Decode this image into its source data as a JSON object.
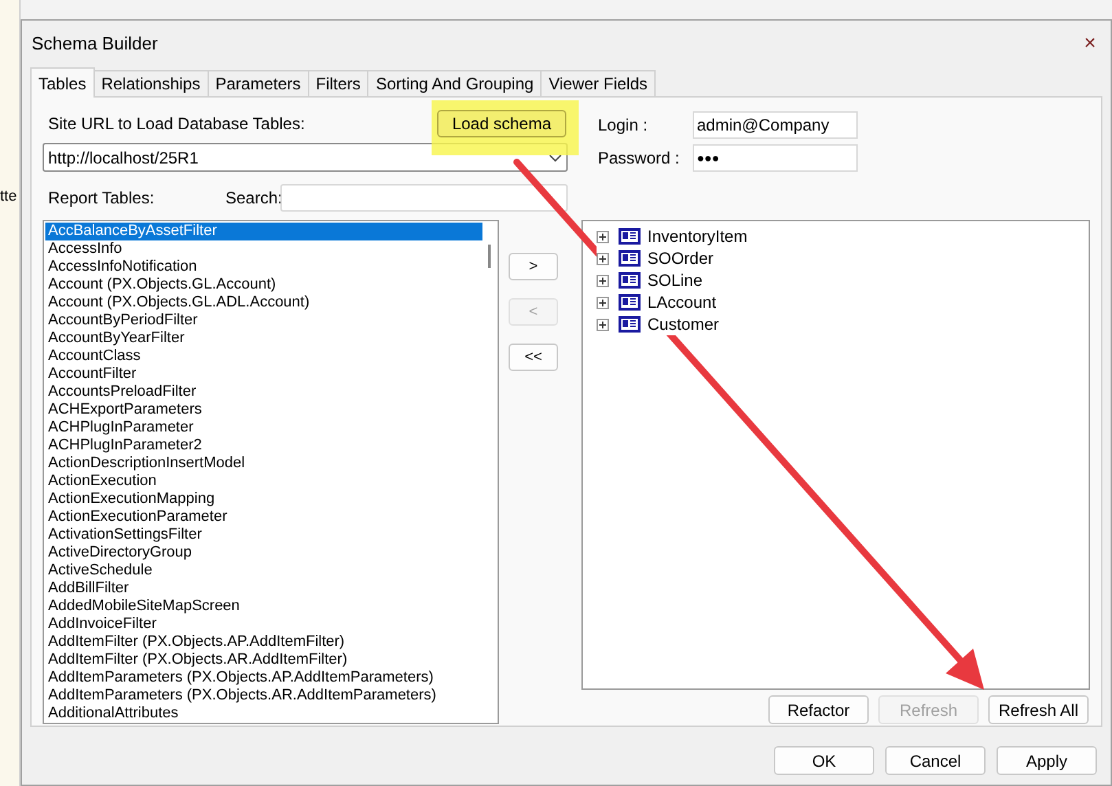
{
  "background_window": {
    "text": "tte"
  },
  "window": {
    "title": "Schema Builder",
    "close": "×"
  },
  "tabs": [
    {
      "label": "Tables",
      "selected": true
    },
    {
      "label": "Relationships",
      "selected": false
    },
    {
      "label": "Parameters",
      "selected": false
    },
    {
      "label": "Filters",
      "selected": false
    },
    {
      "label": "Sorting And Grouping",
      "selected": false
    },
    {
      "label": "Viewer Fields",
      "selected": false
    }
  ],
  "site_url": {
    "label": "Site URL to Load Database Tables:",
    "value": "http://localhost/25R1",
    "load_button": "Load schema"
  },
  "login": {
    "label": "Login :",
    "value": "admin@Company"
  },
  "password": {
    "label": "Password :",
    "value": "●●●"
  },
  "report_tables": {
    "label": "Report Tables:",
    "search_label": "Search:",
    "items": [
      {
        "label": "AccBalanceByAssetFilter",
        "selected": true
      },
      {
        "label": "AccessInfo",
        "selected": false
      },
      {
        "label": "AccessInfoNotification",
        "selected": false
      },
      {
        "label": "Account (PX.Objects.GL.Account)",
        "selected": false
      },
      {
        "label": "Account (PX.Objects.GL.ADL.Account)",
        "selected": false
      },
      {
        "label": "AccountByPeriodFilter",
        "selected": false
      },
      {
        "label": "AccountByYearFilter",
        "selected": false
      },
      {
        "label": "AccountClass",
        "selected": false
      },
      {
        "label": "AccountFilter",
        "selected": false
      },
      {
        "label": "AccountsPreloadFilter",
        "selected": false
      },
      {
        "label": "ACHExportParameters",
        "selected": false
      },
      {
        "label": "ACHPlugInParameter",
        "selected": false
      },
      {
        "label": "ACHPlugInParameter2",
        "selected": false
      },
      {
        "label": "ActionDescriptionInsertModel",
        "selected": false
      },
      {
        "label": "ActionExecution",
        "selected": false
      },
      {
        "label": "ActionExecutionMapping",
        "selected": false
      },
      {
        "label": "ActionExecutionParameter",
        "selected": false
      },
      {
        "label": "ActivationSettingsFilter",
        "selected": false
      },
      {
        "label": "ActiveDirectoryGroup",
        "selected": false
      },
      {
        "label": "ActiveSchedule",
        "selected": false
      },
      {
        "label": "AddBillFilter",
        "selected": false
      },
      {
        "label": "AddedMobileSiteMapScreen",
        "selected": false
      },
      {
        "label": "AddInvoiceFilter",
        "selected": false
      },
      {
        "label": "AddItemFilter (PX.Objects.AP.AddItemFilter)",
        "selected": false
      },
      {
        "label": "AddItemFilter (PX.Objects.AR.AddItemFilter)",
        "selected": false
      },
      {
        "label": "AddItemParameters (PX.Objects.AP.AddItemParameters)",
        "selected": false
      },
      {
        "label": "AddItemParameters (PX.Objects.AR.AddItemParameters)",
        "selected": false
      },
      {
        "label": "AdditionalAttributes",
        "selected": false
      }
    ]
  },
  "move_buttons": [
    {
      "label": ">",
      "disabled": false
    },
    {
      "label": "<",
      "disabled": true
    },
    {
      "label": "<<",
      "disabled": false
    }
  ],
  "schema_tree": [
    {
      "label": "InventoryItem",
      "expanded": false
    },
    {
      "label": "SOOrder",
      "expanded": false
    },
    {
      "label": "SOLine",
      "expanded": false
    },
    {
      "label": "LAccount",
      "expanded": false
    },
    {
      "label": "Customer",
      "expanded": false
    }
  ],
  "tree_buttons": [
    {
      "label": "Refactor",
      "disabled": false
    },
    {
      "label": "Refresh",
      "disabled": true
    },
    {
      "label": "Refresh All",
      "disabled": false
    }
  ],
  "dialog_buttons": [
    {
      "label": "OK"
    },
    {
      "label": "Cancel"
    },
    {
      "label": "Apply"
    }
  ]
}
